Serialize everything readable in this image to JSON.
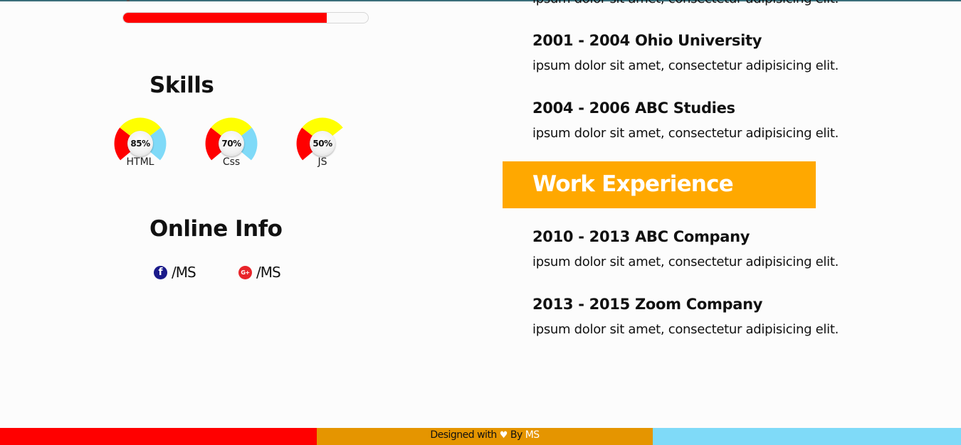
{
  "colors": {
    "accent_red": "#ff0000",
    "accent_yellow": "#ffff00",
    "accent_blue": "#7fdaf8",
    "accent_orange": "#ffa800",
    "footer_orange": "#e59500",
    "facebook_blue": "#1a1a8a",
    "googleplus_red": "#e8242a"
  },
  "top_progress": {
    "percent": 83
  },
  "skills": {
    "title": "Skills",
    "items": [
      {
        "label": "HTML",
        "percent_text": "85%",
        "percent": 85
      },
      {
        "label": "Css",
        "percent_text": "70%",
        "percent": 70
      },
      {
        "label": "JS",
        "percent_text": "50%",
        "percent": 50
      }
    ]
  },
  "online_info": {
    "title": "Online Info",
    "facebook": {
      "icon": "facebook-icon",
      "glyph": "f",
      "handle": "/MS"
    },
    "googleplus": {
      "icon": "google-plus-icon",
      "glyph": "G+",
      "handle": "/MS"
    }
  },
  "education": {
    "partial_desc": "ipsum dolor sit amet, consectetur adipisicing elit.",
    "entries": [
      {
        "title": "2001 - 2004 Ohio University",
        "desc": "ipsum dolor sit amet, consectetur adipisicing elit."
      },
      {
        "title": "2004 - 2006 ABC Studies",
        "desc": "ipsum dolor sit amet, consectetur adipisicing elit."
      }
    ]
  },
  "work": {
    "title": "Work Experience",
    "entries": [
      {
        "title": "2010 - 2013 ABC Company",
        "desc": "ipsum dolor sit amet, consectetur adipisicing elit."
      },
      {
        "title": "2013 - 2015 Zoom Company",
        "desc": "ipsum dolor sit amet, consectetur adipisicing elit."
      }
    ]
  },
  "footer": {
    "designed_with": "Designed with",
    "heart_icon": "heart-icon",
    "heart": "♥",
    "by": "By",
    "author": "MS"
  }
}
